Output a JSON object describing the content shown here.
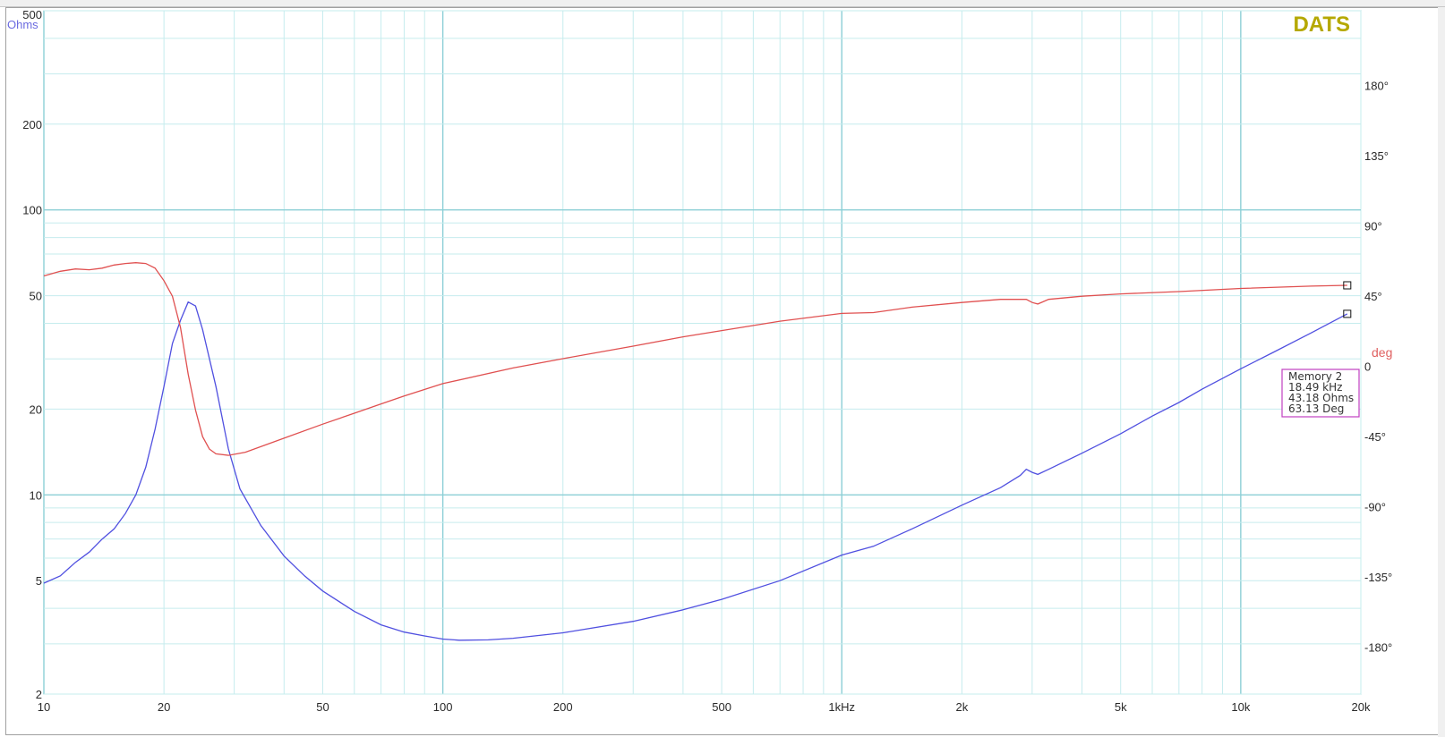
{
  "chart_data": {
    "type": "line",
    "brand": "DATS",
    "x_scale": "log",
    "xlim": [
      10,
      20000
    ],
    "x_ticks": [
      {
        "value": 10,
        "label": "10"
      },
      {
        "value": 20,
        "label": "20"
      },
      {
        "value": 50,
        "label": "50"
      },
      {
        "value": 100,
        "label": "100"
      },
      {
        "value": 200,
        "label": "200"
      },
      {
        "value": 500,
        "label": "500"
      },
      {
        "value": 1000,
        "label": "1kHz"
      },
      {
        "value": 2000,
        "label": "2k"
      },
      {
        "value": 5000,
        "label": "5k"
      },
      {
        "value": 10000,
        "label": "10k"
      },
      {
        "value": 20000,
        "label": "20k"
      }
    ],
    "y_left": {
      "label": "Ohms",
      "scale": "log",
      "lim": [
        2,
        500
      ],
      "ticks": [
        {
          "value": 500,
          "label": "500"
        },
        {
          "value": 200,
          "label": "200"
        },
        {
          "value": 100,
          "label": "100"
        },
        {
          "value": 50,
          "label": "50"
        },
        {
          "value": 20,
          "label": "20"
        },
        {
          "value": 10,
          "label": "10"
        },
        {
          "value": 5,
          "label": "5"
        },
        {
          "value": 2,
          "label": "2"
        }
      ]
    },
    "y_right": {
      "label": "deg",
      "scale": "linear",
      "lim": [
        -210,
        228
      ],
      "ticks": [
        {
          "value": 180,
          "label": "180°"
        },
        {
          "value": 135,
          "label": "135°"
        },
        {
          "value": 90,
          "label": "90°"
        },
        {
          "value": 45,
          "label": "45°"
        },
        {
          "value": 0,
          "label": "0"
        },
        {
          "value": -45,
          "label": "-45°"
        },
        {
          "value": -90,
          "label": "-90°"
        },
        {
          "value": -135,
          "label": "-135°"
        },
        {
          "value": -180,
          "label": "-180°"
        }
      ]
    },
    "grid": true,
    "series": [
      {
        "axis": "left",
        "color": "#5050e0",
        "points": [
          [
            10,
            4.9
          ],
          [
            11,
            5.2
          ],
          [
            12,
            5.8
          ],
          [
            13,
            6.3
          ],
          [
            14,
            7.0
          ],
          [
            15,
            7.6
          ],
          [
            16,
            8.6
          ],
          [
            17,
            10.0
          ],
          [
            18,
            12.5
          ],
          [
            19,
            17.0
          ],
          [
            20,
            24.0
          ],
          [
            21,
            34.0
          ],
          [
            22,
            41.0
          ],
          [
            23,
            47.5
          ],
          [
            24,
            46.0
          ],
          [
            25,
            38.0
          ],
          [
            27,
            24.0
          ],
          [
            29,
            14.5
          ],
          [
            31,
            10.5
          ],
          [
            35,
            7.8
          ],
          [
            40,
            6.1
          ],
          [
            45,
            5.2
          ],
          [
            50,
            4.6
          ],
          [
            60,
            3.9
          ],
          [
            70,
            3.5
          ],
          [
            80,
            3.3
          ],
          [
            90,
            3.2
          ],
          [
            100,
            3.12
          ],
          [
            110,
            3.09
          ],
          [
            130,
            3.1
          ],
          [
            150,
            3.14
          ],
          [
            200,
            3.28
          ],
          [
            300,
            3.6
          ],
          [
            400,
            3.95
          ],
          [
            500,
            4.3
          ],
          [
            700,
            5.0
          ],
          [
            1000,
            6.15
          ],
          [
            1200,
            6.6
          ],
          [
            1500,
            7.6
          ],
          [
            2000,
            9.2
          ],
          [
            2500,
            10.6
          ],
          [
            2800,
            11.7
          ],
          [
            2900,
            12.3
          ],
          [
            3000,
            12.0
          ],
          [
            3100,
            11.8
          ],
          [
            3300,
            12.3
          ],
          [
            4000,
            14.0
          ],
          [
            5000,
            16.4
          ],
          [
            6000,
            18.9
          ],
          [
            7000,
            21.1
          ],
          [
            8000,
            23.5
          ],
          [
            10000,
            27.7
          ],
          [
            12000,
            31.5
          ],
          [
            15000,
            37.0
          ],
          [
            18490,
            43.18
          ]
        ]
      },
      {
        "axis": "right",
        "color": "#e05050",
        "points": [
          [
            10,
            58
          ],
          [
            11,
            61
          ],
          [
            12,
            62.5
          ],
          [
            13,
            62
          ],
          [
            14,
            63
          ],
          [
            15,
            65
          ],
          [
            16,
            66
          ],
          [
            17,
            66.5
          ],
          [
            18,
            66
          ],
          [
            19,
            63
          ],
          [
            20,
            55
          ],
          [
            21,
            45
          ],
          [
            22,
            25
          ],
          [
            23,
            -5
          ],
          [
            24,
            -28
          ],
          [
            25,
            -45
          ],
          [
            26,
            -53
          ],
          [
            27,
            -56
          ],
          [
            29,
            -57
          ],
          [
            32,
            -55
          ],
          [
            40,
            -46
          ],
          [
            50,
            -37
          ],
          [
            60,
            -30
          ],
          [
            70,
            -24
          ],
          [
            80,
            -19
          ],
          [
            100,
            -11
          ],
          [
            150,
            -1
          ],
          [
            200,
            5
          ],
          [
            300,
            13
          ],
          [
            400,
            19
          ],
          [
            500,
            23
          ],
          [
            700,
            29
          ],
          [
            1000,
            34
          ],
          [
            1200,
            34.5
          ],
          [
            1500,
            38
          ],
          [
            2000,
            41
          ],
          [
            2500,
            43
          ],
          [
            2900,
            43
          ],
          [
            3000,
            41
          ],
          [
            3100,
            40
          ],
          [
            3300,
            43
          ],
          [
            4000,
            45
          ],
          [
            5000,
            46.5
          ],
          [
            7000,
            48
          ],
          [
            10000,
            50
          ],
          [
            15000,
            51.5
          ],
          [
            18490,
            52
          ]
        ]
      }
    ],
    "annotation": {
      "lines": [
        "Memory 2",
        "18.49 kHz",
        "43.18 Ohms",
        "63.13 Deg"
      ],
      "border_color": "#c040c0"
    }
  }
}
